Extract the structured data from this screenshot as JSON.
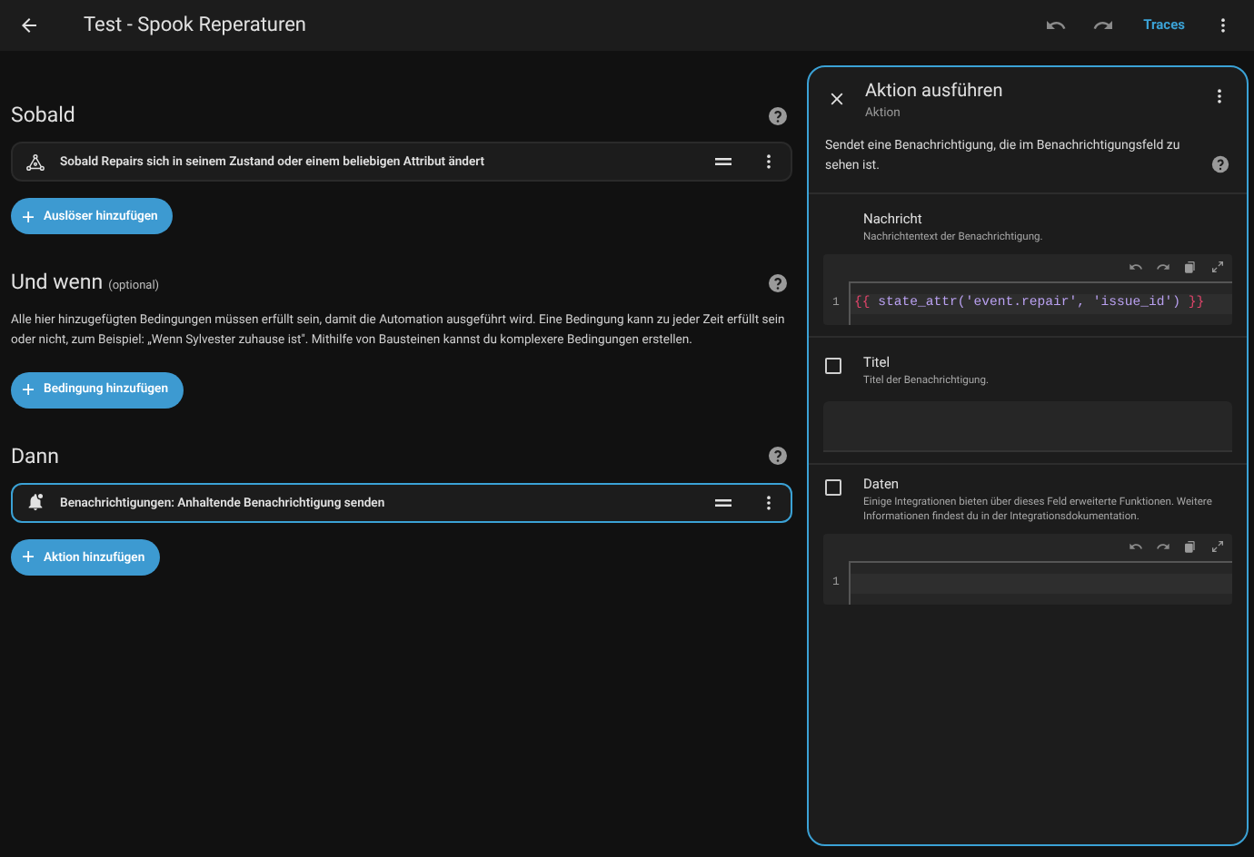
{
  "top_bar": {
    "title": "Test - Spook Reperaturen",
    "traces": "Traces"
  },
  "sections": [
    {
      "title": "Sobald",
      "items": [
        {
          "kind": "trigger",
          "label": "Sobald Repairs sich in seinem Zustand oder einem beliebigen Attribut ändert",
          "selected": false
        }
      ],
      "add_button": "Auslöser hinzufügen"
    },
    {
      "title": "Und wenn",
      "note": "(optional)",
      "description": "Alle hier hinzugefügten Bedingungen müssen erfüllt sein, damit die Automation ausgeführt wird. Eine Bedingung kann zu jeder Zeit erfüllt sein oder nicht, zum Beispiel: „Wenn Sylvester zuhause ist\". Mithilfe von Bausteinen kannst du komplexere Bedingungen erstellen.",
      "add_button": "Bedingung hinzufügen"
    },
    {
      "title": "Dann",
      "items": [
        {
          "kind": "notification",
          "label": "Benachrichtigungen: Anhaltende Benachrichtigung senden",
          "selected": true
        }
      ],
      "add_button": "Aktion hinzufügen"
    }
  ],
  "panel": {
    "title": "Aktion ausführen",
    "subtitle": "Aktion",
    "description": "Sendet eine Benachrichtigung, die im Benachrichtigungsfeld zu sehen ist.",
    "fields": [
      {
        "kind": "code",
        "label": "Nachricht",
        "description": "Nachrichtentext der Benachrichtigung.",
        "line_number": "1",
        "code": [
          {
            "text": "{{",
            "kind": "brace"
          },
          {
            "text": " state_attr('event.repair', 'issue_id') ",
            "kind": "expr"
          },
          {
            "text": "}}",
            "kind": "brace"
          }
        ]
      },
      {
        "kind": "text",
        "label": "Titel",
        "description": "Titel der Benachrichtigung.",
        "checked": false
      },
      {
        "kind": "code",
        "label": "Daten",
        "description": "Einige Integrationen bieten über dieses Feld erweiterte Funktionen. Weitere Informationen findest du in der Integrationsdokumentation.",
        "line_number": "1",
        "checked": false
      }
    ]
  }
}
